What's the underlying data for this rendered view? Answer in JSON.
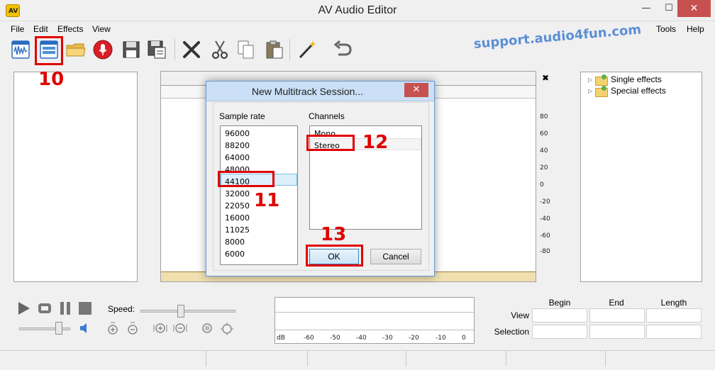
{
  "window": {
    "title": "AV Audio Editor",
    "app_icon_text": "AV",
    "minimize_glyph": "—",
    "maximize_glyph": "☐",
    "close_glyph": "✕"
  },
  "menu": {
    "left": [
      "File",
      "Edit",
      "Effects",
      "View"
    ],
    "right": [
      "Tools",
      "Help"
    ]
  },
  "toolbar": {
    "buttons": [
      "new-audio-icon",
      "new-multitrack-icon",
      "open-folder-icon",
      "record-icon",
      "save-icon",
      "save-as-icon",
      "delete-icon",
      "cut-icon",
      "copy-icon",
      "paste-icon",
      "effects-wand-icon",
      "undo-icon"
    ]
  },
  "watermark": "support.audio4fun.com",
  "annotations": {
    "n10": "10",
    "n11": "11",
    "n12": "12",
    "n13": "13"
  },
  "waveform": {
    "close_glyph": "✖",
    "db_ticks": [
      "80",
      "60",
      "40",
      "20",
      "0",
      "-20",
      "-40",
      "-60",
      "-80"
    ]
  },
  "effects_tree": {
    "items": [
      "Single effects",
      "Special effects"
    ]
  },
  "transport": {
    "speed_label": "Speed:",
    "speed_level": 0.42,
    "volume_level": 0.82
  },
  "meter": {
    "labels": [
      "dB",
      "-60",
      "-50",
      "-40",
      "-30",
      "-20",
      "-10",
      "0"
    ]
  },
  "time_panel": {
    "headers": [
      "Begin",
      "End",
      "Length"
    ],
    "rows": [
      "View",
      "Selection"
    ]
  },
  "dialog": {
    "title": "New Multitrack Session...",
    "close_glyph": "✕",
    "sample_rate_label": "Sample rate",
    "sample_rates": [
      "96000",
      "88200",
      "64000",
      "48000",
      "44100",
      "32000",
      "22050",
      "16000",
      "11025",
      "8000",
      "6000"
    ],
    "selected_sample_rate": "44100",
    "channels_label": "Channels",
    "channels": [
      "Mono",
      "Stereo"
    ],
    "selected_channel": "Stereo",
    "ok_label": "OK",
    "cancel_label": "Cancel"
  },
  "colors": {
    "annotation_red": "#e00000",
    "watermark_blue": "#5b8fd6",
    "close_red": "#c75050",
    "dialog_title_bg": "#cbe0f6"
  }
}
